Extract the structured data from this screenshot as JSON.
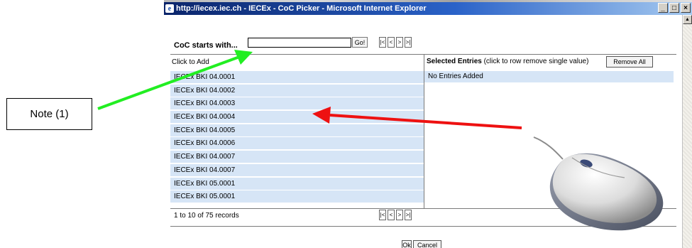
{
  "note": {
    "label": "Note (1)"
  },
  "window": {
    "title": "http://iecex.iec.ch - IECEx - CoC Picker - Microsoft Internet Explorer",
    "minimize": "_",
    "maximize": "□",
    "close": "×"
  },
  "search": {
    "label": "CoC starts with...",
    "value": "",
    "go_label": "Go!"
  },
  "pager": {
    "first": "|<",
    "prev": "<",
    "next": ">",
    "last": ">|"
  },
  "available": {
    "header": "Click to Add",
    "items": [
      "IECEx BKI 04.0001",
      "IECEx BKI 04.0002",
      "IECEx BKI 04.0003",
      "IECEx BKI 04.0004",
      "IECEx BKI 04.0005",
      "IECEx BKI 04.0006",
      "IECEx BKI 04.0007",
      "IECEx BKI 04.0007",
      "IECEx BKI 05.0001",
      "IECEx BKI 05.0001"
    ]
  },
  "selected": {
    "header_bold": "Selected Entries",
    "header_rest": " (click to row remove single value)",
    "remove_all_label": "Remove All",
    "empty_text": "No Entries Added"
  },
  "records": {
    "text": "1 to 10 of 75 records"
  },
  "buttons": {
    "ok": "Ok",
    "cancel": "Cancel"
  },
  "colors": {
    "row_fill": "#d6e5f6",
    "title_start": "#0a246a",
    "title_end": "#a6caf0",
    "green_arrow": "#22ee22",
    "red_arrow": "#ee1111"
  },
  "icons": {
    "title": "ie-page-icon",
    "mouse": "computer-mouse-icon"
  }
}
